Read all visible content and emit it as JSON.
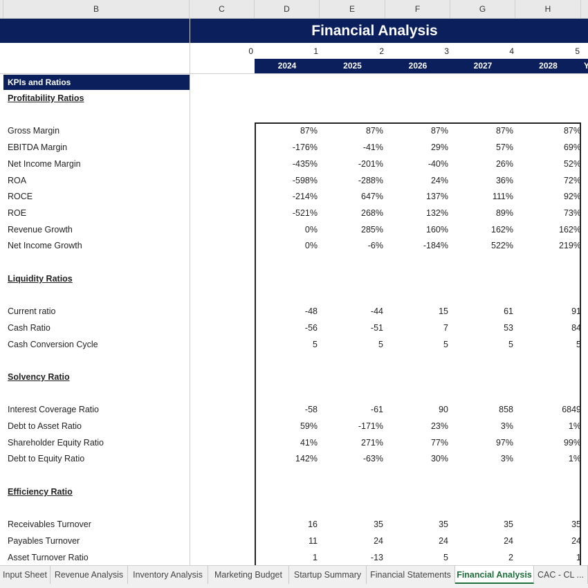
{
  "column_headers": [
    "B",
    "C",
    "D",
    "E",
    "F",
    "G",
    "H"
  ],
  "title": "Financial Analysis",
  "period_index": [
    "0",
    "1",
    "2",
    "3",
    "4",
    "5"
  ],
  "years": [
    "2024",
    "2025",
    "2026",
    "2027",
    "2028",
    "Y"
  ],
  "kpi_header": "KPIs and Ratios",
  "sections": {
    "profitability": "Profitability Ratios",
    "liquidity": "Liquidity Ratios",
    "solvency": "Solvency Ratio",
    "efficiency": "Efficiency Ratio"
  },
  "rows": [
    {
      "label": "Gross Margin",
      "values": [
        "87%",
        "87%",
        "87%",
        "87%",
        "87%"
      ]
    },
    {
      "label": "EBITDA Margin",
      "values": [
        "-176%",
        "-41%",
        "29%",
        "57%",
        "69%"
      ]
    },
    {
      "label": "Net Income Margin",
      "values": [
        "-435%",
        "-201%",
        "-40%",
        "26%",
        "52%"
      ]
    },
    {
      "label": "ROA",
      "values": [
        "-598%",
        "-288%",
        "24%",
        "36%",
        "72%"
      ]
    },
    {
      "label": "ROCE",
      "values": [
        "-214%",
        "647%",
        "137%",
        "111%",
        "92%"
      ]
    },
    {
      "label": "ROE",
      "values": [
        "-521%",
        "268%",
        "132%",
        "89%",
        "73%"
      ]
    },
    {
      "label": "Revenue Growth",
      "values": [
        "0%",
        "285%",
        "160%",
        "162%",
        "162%"
      ]
    },
    {
      "label": "Net Income Growth",
      "values": [
        "0%",
        "-6%",
        "-184%",
        "522%",
        "219%"
      ]
    },
    {
      "label": "Current ratio",
      "values": [
        "-48",
        "-44",
        "15",
        "61",
        "91"
      ]
    },
    {
      "label": "Cash Ratio",
      "values": [
        "-56",
        "-51",
        "7",
        "53",
        "84"
      ]
    },
    {
      "label": "Cash Conversion Cycle",
      "values": [
        "5",
        "5",
        "5",
        "5",
        "5"
      ]
    },
    {
      "label": "Interest Coverage Ratio",
      "values": [
        "-58",
        "-61",
        "90",
        "858",
        "6849"
      ]
    },
    {
      "label": "Debt to Asset Ratio",
      "values": [
        "59%",
        "-171%",
        "23%",
        "3%",
        "1%"
      ]
    },
    {
      "label": "Shareholder Equity Ratio",
      "values": [
        "41%",
        "271%",
        "77%",
        "97%",
        "99%"
      ]
    },
    {
      "label": "Debt to Equity Ratio",
      "values": [
        "142%",
        "-63%",
        "30%",
        "3%",
        "1%"
      ]
    },
    {
      "label": "Receivables Turnover",
      "values": [
        "16",
        "35",
        "35",
        "35",
        "35"
      ]
    },
    {
      "label": "Payables Turnover",
      "values": [
        "11",
        "24",
        "24",
        "24",
        "24"
      ]
    },
    {
      "label": "Asset Turnover Ratio",
      "values": [
        "1",
        "-13",
        "5",
        "2",
        "1"
      ]
    }
  ],
  "sheet_tabs": [
    {
      "label": "Input Sheet",
      "active": false
    },
    {
      "label": "Revenue Analysis",
      "active": false
    },
    {
      "label": "Inventory Analysis",
      "active": false
    },
    {
      "label": "Marketing Budget",
      "active": false
    },
    {
      "label": "Startup Summary",
      "active": false
    },
    {
      "label": "Financial Statements",
      "active": false
    },
    {
      "label": "Financial Analysis",
      "active": true
    },
    {
      "label": "CAC - CL ...",
      "active": false
    }
  ],
  "colors": {
    "header_navy": "#0a1f5c",
    "active_tab": "#1e6e3a"
  }
}
